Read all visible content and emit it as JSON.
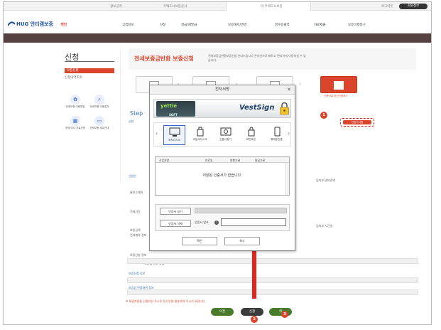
{
  "topbar": {
    "links": [
      "정보공개",
      "주택도시보증공사",
      "이-주택도시보증",
      "로그아웃"
    ],
    "login": "회원정보"
  },
  "nav": {
    "logo": "HUG 안티캠보증",
    "logo_tag": "개인",
    "items": [
      "고객정보",
      "신청",
      "청급/재발급",
      "보증해지/변경",
      "영수증출력",
      "자료제출",
      "보증이행청구"
    ]
  },
  "sidebar": {
    "title": "신청",
    "menu": [
      "보증신청",
      "신청내역조회"
    ],
    "icons": [
      "전세보증 이용방법",
      "전세보증 이용절차",
      "청약/이사 자료신청",
      "전세보증 제도안내"
    ]
  },
  "banner": {
    "title": "전세보증금반환 보증신청",
    "desc": "전세보증금반환보증신청 안내드립니다 온라인으로 빠르고 편리하게 이용하실 수 있습니다."
  },
  "steps": {
    "active_label": "인증서로 본인인증하기"
  },
  "page": {
    "step_heading": "Step",
    "cert_button": "인증서서명",
    "section_labels": [
      "신청",
      "신청인",
      "보증신청 정보",
      "보증금 반환채권 정보"
    ],
    "row_labels": [
      "물건소재지",
      "전세기간",
      "보증금액",
      "전세계약 정보",
      "보증신청 정보",
      "보증금 반환 방법",
      "은행",
      "예금주"
    ],
    "right_labels": [
      "임차부 면보증액",
      "임차부 시근일"
    ],
    "note": "※ 채권자명을 신청하신 주소로 등기우편 발송하며 주시기 바랍니다.",
    "buttons": [
      "이전",
      "신청",
      "취"
    ]
  },
  "badges": [
    "1",
    "2",
    "3"
  ],
  "dialog": {
    "title": "전자서명",
    "brand_left": "yettie",
    "brand_left_sub": "SOFT",
    "brand_right": "VestSign",
    "media": [
      "하드디스크",
      "이동식디스크",
      "인증서찾기",
      "보안토큰",
      "휴대폰인증"
    ],
    "table_headers": [
      "사업자명",
      "만료일",
      "발행기관",
      "발급기관"
    ],
    "empty_msg": "저장된 인증서가 없습니다.",
    "view_cert": "인증서 보기",
    "delete_cert": "인증서 삭제",
    "pw_label": "인증서 암호",
    "ok": "확인",
    "cancel": "취소"
  },
  "colors": {
    "accent": "#d9442b",
    "nav_band": "#55413f",
    "link_blue": "#3b6fb0",
    "arrow_red": "#e0271f"
  }
}
